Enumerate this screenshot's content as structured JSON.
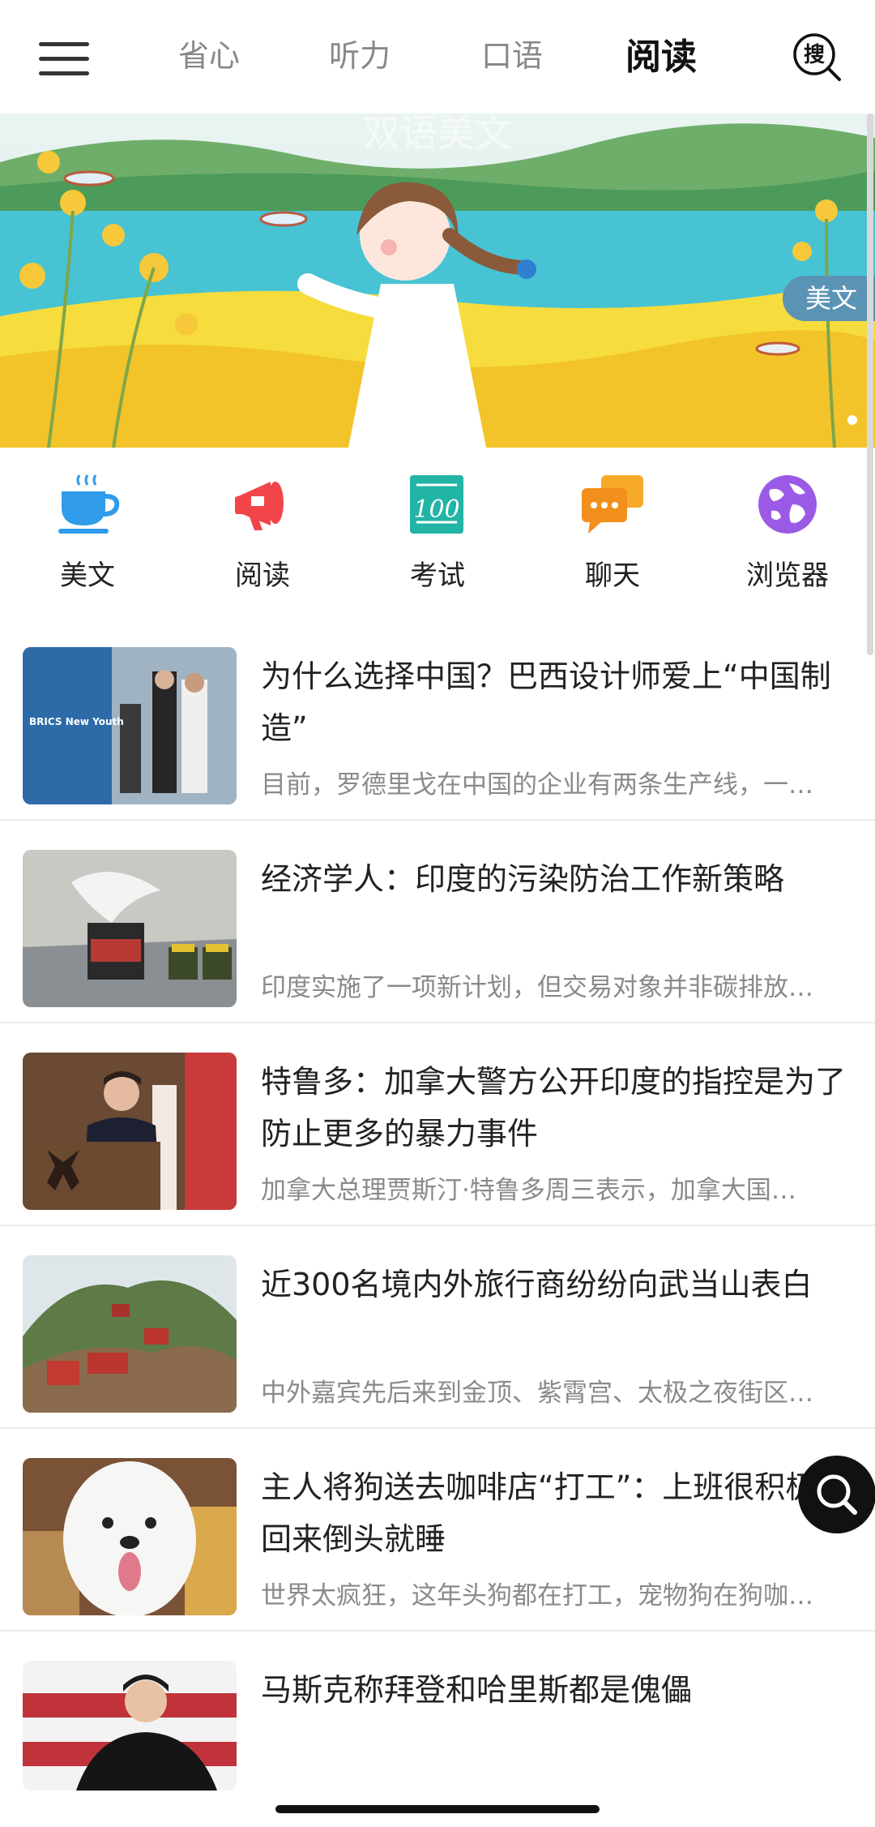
{
  "nav": {
    "tabs": [
      "省心",
      "听力",
      "口语",
      "阅读"
    ],
    "active_tab": "阅读",
    "search_icon_text": "搜"
  },
  "banner": {
    "watermark": "双语美文",
    "badge": "美文"
  },
  "categories": [
    {
      "label": "美文",
      "icon": "teacup-icon",
      "color": "#2f9bea"
    },
    {
      "label": "阅读",
      "icon": "megaphone-icon",
      "color": "#f2454a"
    },
    {
      "label": "考试",
      "icon": "score-100-icon",
      "color": "#22b4a4"
    },
    {
      "label": "聊天",
      "icon": "chat-bubbles-icon",
      "color": "#f7a928"
    },
    {
      "label": "浏览器",
      "icon": "globe-icon",
      "color": "#9b5ae6"
    }
  ],
  "articles": [
    {
      "title": "为什么选择中国？巴西设计师爱上“中国制造”",
      "summary": "目前，罗德里戈在中国的企业有两条生产线，一…",
      "thumb_text": "BRICS New Youth"
    },
    {
      "title": "经济学人：印度的污染防治工作新策略",
      "summary": "印度实施了一项新计划，但交易对象并非碳排放…"
    },
    {
      "title": "特鲁多：加拿大警方公开印度的指控是为了防止更多的暴力事件",
      "summary": "加拿大总理贾斯汀·特鲁多周三表示，加拿大国…"
    },
    {
      "title": "近300名境内外旅行商纷纷向武当山表白",
      "summary": "中外嘉宾先后来到金顶、紫霄宫、太极之夜街区…"
    },
    {
      "title": "主人将狗送去咖啡店“打工”：上班很积极，回来倒头就睡",
      "summary": "世界太疯狂，这年头狗都在打工，宠物狗在狗咖…"
    },
    {
      "title": "马斯克称拜登和哈里斯都是傀儡",
      "summary": ""
    }
  ],
  "colors": {
    "accent_blue": "#5b93b5",
    "text_main": "#222222",
    "text_muted": "#8a8a8a"
  }
}
